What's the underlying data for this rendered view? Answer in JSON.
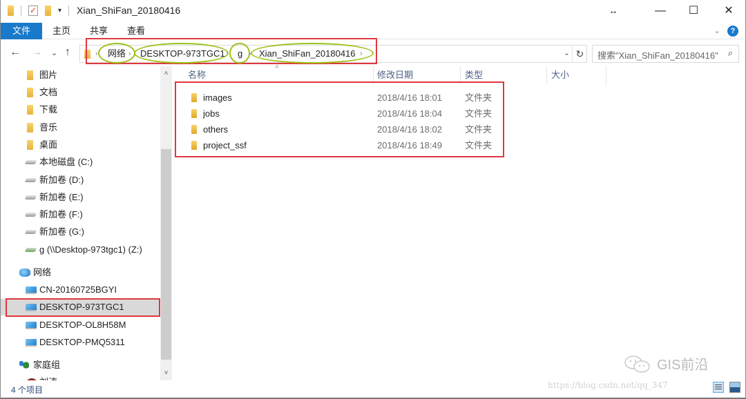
{
  "window": {
    "title": "Xian_ShiFan_20180416",
    "quick_access_dropdown": "▾",
    "controls": {
      "resize": "↔",
      "minimize": "—",
      "maximize": "☐",
      "close": "✕"
    }
  },
  "ribbon": {
    "tabs": [
      {
        "label": "文件",
        "active": true
      },
      {
        "label": "主页"
      },
      {
        "label": "共享"
      },
      {
        "label": "查看"
      }
    ],
    "expand_icon": "⌄",
    "help_label": "?"
  },
  "nav": {
    "back": "←",
    "forward": "→",
    "recent": "⌄",
    "up": "↑"
  },
  "address": {
    "breadcrumb": [
      "网络",
      "DESKTOP-973TGC1",
      "g",
      "Xian_ShiFan_20180416"
    ],
    "separator": "›",
    "dropdown": "⌄",
    "refresh": "↻"
  },
  "search": {
    "placeholder": "搜索\"Xian_ShiFan_20180416\"",
    "icon": "⌕"
  },
  "sidebar": {
    "items": [
      {
        "label": "图片",
        "icon": "pictures-folder"
      },
      {
        "label": "文档",
        "icon": "documents-folder"
      },
      {
        "label": "下载",
        "icon": "downloads-folder"
      },
      {
        "label": "音乐",
        "icon": "music-folder"
      },
      {
        "label": "桌面",
        "icon": "desktop-folder"
      },
      {
        "label": "本地磁盘 (C:)",
        "icon": "system-drive"
      },
      {
        "label": "新加卷 (D:)",
        "icon": "drive"
      },
      {
        "label": "新加卷 (E:)",
        "icon": "drive"
      },
      {
        "label": "新加卷 (F:)",
        "icon": "drive"
      },
      {
        "label": "新加卷 (G:)",
        "icon": "drive"
      },
      {
        "label": "g (\\\\Desktop-973tgc1) (Z:)",
        "icon": "network-drive"
      },
      {
        "label": "网络",
        "icon": "network"
      },
      {
        "label": "CN-20160725BGYI",
        "icon": "computer"
      },
      {
        "label": "DESKTOP-973TGC1",
        "icon": "computer",
        "selected": true
      },
      {
        "label": "DESKTOP-OL8H58M",
        "icon": "computer"
      },
      {
        "label": "DESKTOP-PMQ5311",
        "icon": "computer"
      },
      {
        "label": "家庭组",
        "icon": "homegroup"
      },
      {
        "label": "刘涛",
        "icon": "user"
      }
    ],
    "scroll_up": "˄",
    "scroll_down": "˅"
  },
  "columns": {
    "name": "名称",
    "modified": "修改日期",
    "type": "类型",
    "size": "大小",
    "sort_indicator": "˄"
  },
  "files": [
    {
      "name": "images",
      "modified": "2018/4/16 18:01",
      "type": "文件夹"
    },
    {
      "name": "jobs",
      "modified": "2018/4/16 18:04",
      "type": "文件夹"
    },
    {
      "name": "others",
      "modified": "2018/4/16 18:02",
      "type": "文件夹"
    },
    {
      "name": "project_ssf",
      "modified": "2018/4/16 18:49",
      "type": "文件夹"
    }
  ],
  "status": {
    "item_count": "4 个项目"
  },
  "watermark": {
    "brand": "GIS前沿",
    "url": "https://blog.csdn.net/qq_347"
  },
  "colors": {
    "accent": "#1979ca",
    "annotation_red": "#e0373e",
    "annotation_green": "#9cc21a",
    "selected_bg": "#d9d9d9"
  }
}
